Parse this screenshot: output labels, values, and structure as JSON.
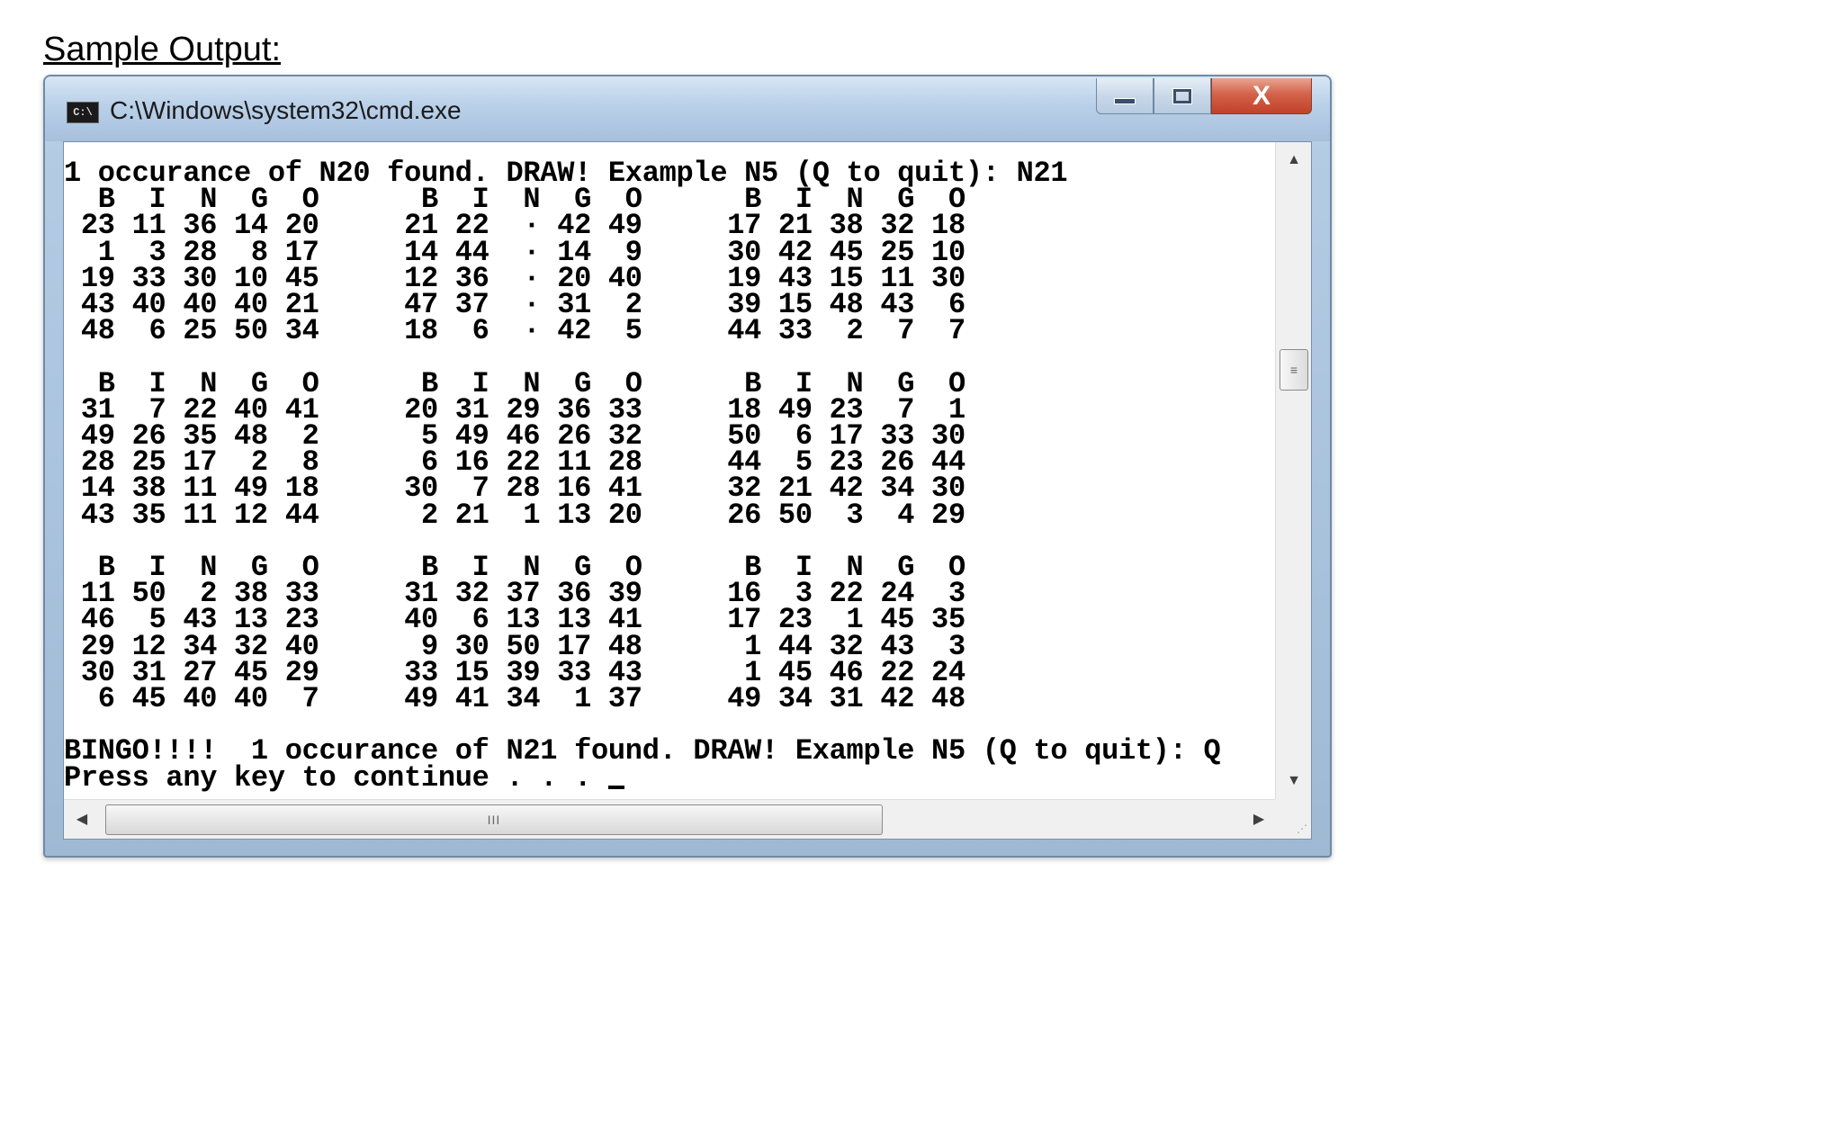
{
  "heading": "Sample Output:",
  "window": {
    "title": "C:\\Windows\\system32\\cmd.exe",
    "icon_label": "C:\\",
    "icon": "console-icon",
    "buttons": {
      "minimize_icon": "minimize-icon",
      "maximize_icon": "maximize-icon",
      "close_glyph": "X"
    }
  },
  "console": {
    "lines": [
      "1 occurance of N20 found. DRAW! Example N5 (Q to quit): N21",
      "  B  I  N  G  O      B  I  N  G  O      B  I  N  G  O",
      " 23 11 36 14 20     21 22  · 42 49     17 21 38 32 18",
      "  1  3 28  8 17     14 44  · 14  9     30 42 45 25 10",
      " 19 33 30 10 45     12 36  · 20 40     19 43 15 11 30",
      " 43 40 40 40 21     47 37  · 31  2     39 15 48 43  6",
      " 48  6 25 50 34     18  6  · 42  5     44 33  2  7  7",
      "",
      "  B  I  N  G  O      B  I  N  G  O      B  I  N  G  O",
      " 31  7 22 40 41     20 31 29 36 33     18 49 23  7  1",
      " 49 26 35 48  2      5 49 46 26 32     50  6 17 33 30",
      " 28 25 17  2  8      6 16 22 11 28     44  5 23 26 44",
      " 14 38 11 49 18     30  7 28 16 41     32 21 42 34 30",
      " 43 35 11 12 44      2 21  1 13 20     26 50  3  4 29",
      "",
      "  B  I  N  G  O      B  I  N  G  O      B  I  N  G  O",
      " 11 50  2 38 33     31 32 37 36 39     16  3 22 24  3",
      " 46  5 43 13 23     40  6 13 13 41     17 23  1 45 35",
      " 29 12 34 32 40      9 30 50 17 48      1 44 32 43  3",
      " 30 31 27 45 29     33 15 39 33 43      1 45 46 22 24",
      "  6 45 40 40  7     49 41 34  1 37     49 34 31 42 48",
      "",
      "BINGO!!!!  1 occurance of N21 found. DRAW! Example N5 (Q to quit): Q",
      "Press any key to continue . . . "
    ]
  },
  "scrollbars": {
    "up_arrow": "▲",
    "down_arrow": "▼",
    "left_arrow": "◀",
    "right_arrow": "▶",
    "grip": "≡",
    "h_grip": "III"
  }
}
